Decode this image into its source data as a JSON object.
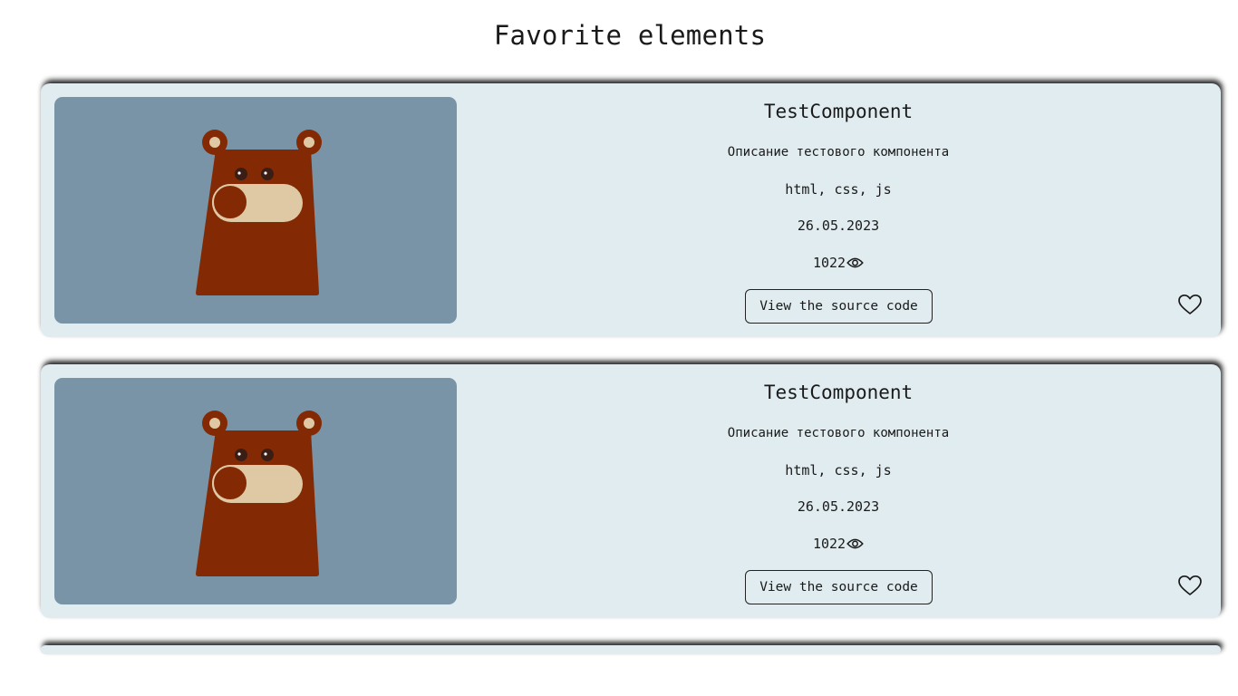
{
  "page": {
    "title": "Favorite elements"
  },
  "cards": [
    {
      "title": "TestComponent",
      "description": "Описание тестового компонента",
      "tags": "html, css, js",
      "date": "26.05.2023",
      "views": "1022",
      "source_label": "View the source code",
      "favorited": false
    },
    {
      "title": "TestComponent",
      "description": "Описание тестового компонента",
      "tags": "html, css, js",
      "date": "26.05.2023",
      "views": "1022",
      "source_label": "View the source code",
      "favorited": false
    }
  ],
  "colors": {
    "card_background": "#e1ecf0",
    "preview_background": "#7994a6",
    "bear_body": "#832a04",
    "bear_snout": "#dfc9a4",
    "bear_eyes": "#3a1e16"
  },
  "icons": [
    "eye-icon",
    "heart-icon",
    "bear-illustration"
  ]
}
